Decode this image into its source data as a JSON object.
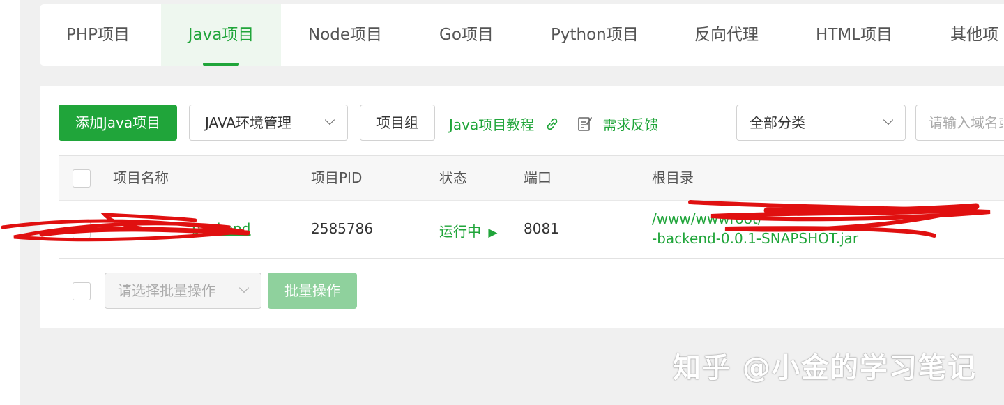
{
  "tabs": [
    {
      "label": "PHP项目"
    },
    {
      "label": "Java项目"
    },
    {
      "label": "Node项目"
    },
    {
      "label": "Go项目"
    },
    {
      "label": "Python项目"
    },
    {
      "label": "反向代理"
    },
    {
      "label": "HTML项目"
    },
    {
      "label": "其他项"
    }
  ],
  "toolbar": {
    "add_label": "添加Java项目",
    "env_label": "JAVA环境管理",
    "group_label": "项目组",
    "tutorial_label": "Java项目教程",
    "feedback_label": "需求反馈",
    "category_value": "全部分类",
    "search_placeholder": "请输入域名或"
  },
  "table": {
    "headers": {
      "name": "项目名称",
      "pid": "项目PID",
      "status": "状态",
      "port": "端口",
      "root": "根目录"
    },
    "rows": [
      {
        "name": "backend",
        "pid": "2585786",
        "status": "运行中",
        "port": "8081",
        "root_line1": "/www/wwwroot/",
        "root_line2": "-backend-0.0.1-SNAPSHOT.jar"
      }
    ]
  },
  "batch": {
    "select_placeholder": "请选择批量操作",
    "button_label": "批量操作"
  },
  "watermark": "知乎 @小金的学习笔记",
  "colors": {
    "accent": "#20a53a",
    "redaction": "#e01010"
  }
}
